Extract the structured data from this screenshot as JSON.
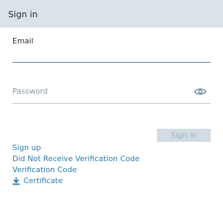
{
  "header": {
    "title": "Sign in"
  },
  "form": {
    "email_label": "Email",
    "email_value": "",
    "password_placeholder": "Password",
    "password_value": "",
    "signin_label": "Sign in"
  },
  "links": {
    "signup": "Sign up",
    "no_verification": "Did Not Receive Verification Code",
    "verification_code": "Verification Code",
    "certificate": "Certificate"
  },
  "icons": {
    "password_toggle": "eye-icon",
    "certificate": "download-icon"
  },
  "colors": {
    "header_bg": "#dbe3ea",
    "link": "#2a7cae",
    "button_disabled_bg": "#d1dbe2",
    "button_disabled_text": "#9fb0bc"
  }
}
